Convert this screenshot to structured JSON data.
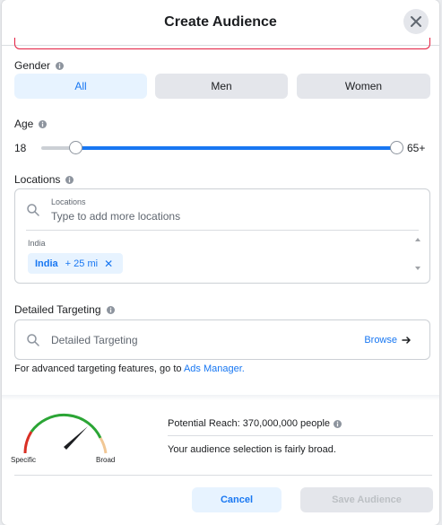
{
  "dialog": {
    "title": "Create Audience"
  },
  "gender": {
    "label": "Gender",
    "options": [
      "All",
      "Men",
      "Women"
    ],
    "selected": "All"
  },
  "age": {
    "label": "Age",
    "min_value": "18",
    "max_value": "65+",
    "range_fraction": [
      0.0,
      1.0
    ]
  },
  "locations": {
    "label": "Locations",
    "input_label": "Locations",
    "placeholder": "Type to add more locations",
    "country_label": "India",
    "selected": {
      "name": "India",
      "radius": "+ 25 mi",
      "remove": "✕"
    }
  },
  "detailed_targeting": {
    "label": "Detailed Targeting",
    "placeholder": "Detailed Targeting",
    "browse_label": "Browse"
  },
  "advanced": {
    "text": "For advanced targeting features, go to",
    "link": "Ads Manager."
  },
  "reach": {
    "gauge_low": "Specific",
    "gauge_high": "Broad",
    "potential_reach": "Potential Reach: 370,000,000 people",
    "description": "Your audience selection is fairly broad."
  },
  "footer": {
    "cancel_label": "Cancel",
    "save_label": "Save Audience"
  },
  "colors": {
    "accent": "#1877f2",
    "error": "#e41e3f",
    "gauge_red": "#d93025",
    "gauge_green": "#2ba535",
    "gauge_tan": "#f1c795"
  },
  "icons": {
    "close": "close-icon",
    "info": "info-icon",
    "search": "search-icon",
    "arrow": "arrow-right-icon"
  }
}
